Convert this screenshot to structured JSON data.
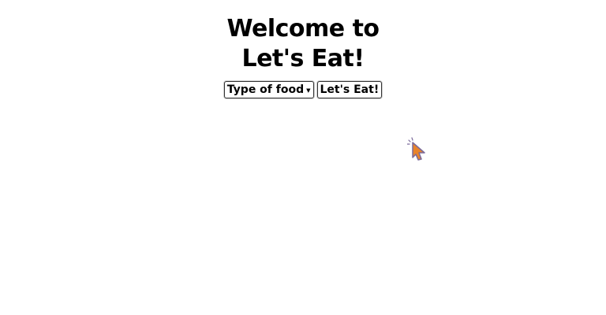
{
  "header": {
    "title_line1": "Welcome to",
    "title_line2": "Let's Eat!"
  },
  "food_select": {
    "selected": "Type of food",
    "arrow_icon": "chevron-down-icon"
  },
  "submit": {
    "label": "Let's Eat!"
  },
  "cursor": {
    "icon": "mouse-pointer-icon",
    "color": "#e8832a"
  }
}
